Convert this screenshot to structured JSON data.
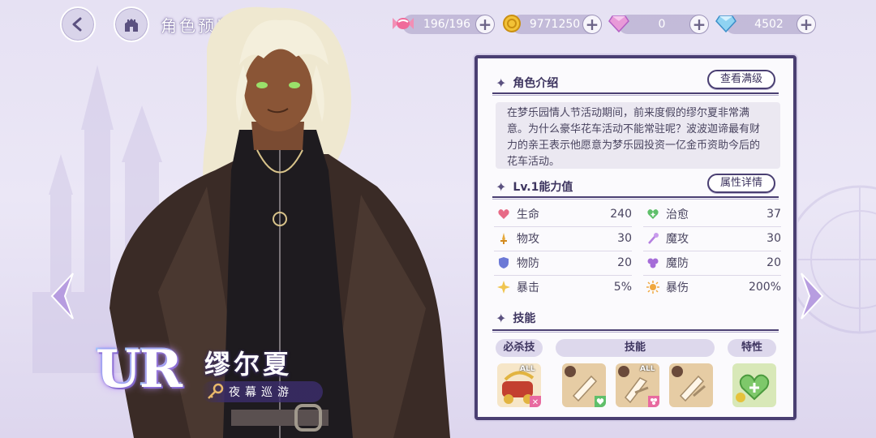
{
  "header": {
    "title": "角色预览"
  },
  "resources": [
    {
      "name": "stamina",
      "icon": "candy-icon",
      "value": "196/196"
    },
    {
      "name": "gold",
      "icon": "gold-coin-icon",
      "value": "9771250"
    },
    {
      "name": "paid-gem",
      "icon": "pink-diamond-icon",
      "value": "0"
    },
    {
      "name": "gem",
      "icon": "blue-diamond-icon",
      "value": "4502"
    }
  ],
  "character": {
    "rarity": "UR",
    "name": "缪尔夏",
    "epithet": "夜幕巡游"
  },
  "profile": {
    "section_title": "角色介绍",
    "max_level_button": "查看满级",
    "description": "在梦乐园情人节活动期间，前来度假的缪尔夏非常满意。为什么豪华花车活动不能常驻呢？波波迦谛最有财力的亲王表示他愿意为梦乐园投资一亿金币资助今后的花车活动。"
  },
  "stats_section": {
    "title": "Lv.1能力值",
    "detail_button": "属性详情",
    "items": [
      {
        "label": "生命",
        "value": "240",
        "icon": "heart-icon",
        "color": "#e76a86"
      },
      {
        "label": "治愈",
        "value": "37",
        "icon": "heal-heart-icon",
        "color": "#5fbf6a"
      },
      {
        "label": "物攻",
        "value": "30",
        "icon": "sword-icon",
        "color": "#e6a93c"
      },
      {
        "label": "魔攻",
        "value": "30",
        "icon": "wand-icon",
        "color": "#b47fe0"
      },
      {
        "label": "物防",
        "value": "20",
        "icon": "shield-icon",
        "color": "#6c79d6"
      },
      {
        "label": "魔防",
        "value": "20",
        "icon": "magic-shield-icon",
        "color": "#a56cd8"
      },
      {
        "label": "暴击",
        "value": "5%",
        "icon": "crit-star-icon",
        "color": "#f0c550"
      },
      {
        "label": "暴伤",
        "value": "200%",
        "icon": "crit-burst-icon",
        "color": "#f0a840"
      }
    ]
  },
  "skills_section": {
    "title": "技能",
    "tabs": {
      "ultimate": "必杀技",
      "skill": "技能",
      "trait": "特性"
    },
    "badge_all": "ALL"
  }
}
